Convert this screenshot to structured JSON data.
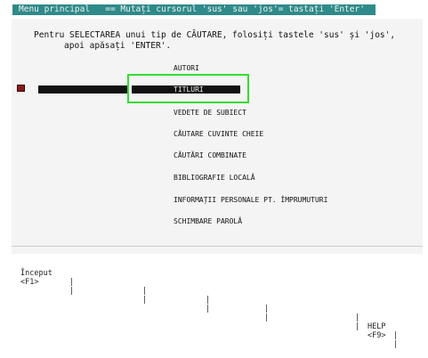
{
  "header": {
    "title": "Menu principal   == Mutați cursorul 'sus' sau 'jos'= tastați 'Enter'"
  },
  "instructions": {
    "line1": "Pentru SELECTAREA unui tip de CĂUTARE, folosiți tastele 'sus' și 'jos',",
    "line2": "apoi apăsați 'ENTER'."
  },
  "menu": {
    "items": [
      {
        "label": "AUTORI"
      },
      {
        "label": "TITLURI"
      },
      {
        "label": "VEDETE DE SUBIECT"
      },
      {
        "label": "CĂUTARE CUVINTE CHEIE"
      },
      {
        "label": "CĂUTĂRI COMBINATE"
      },
      {
        "label": "BIBLIOGRAFIE LOCALĂ"
      },
      {
        "label": "INFORMAȚII PERSONALE PT. ÎMPRUMUTURI"
      },
      {
        "label": "SCHIMBARE PAROLĂ"
      }
    ],
    "selected_index": 1
  },
  "function_keys": {
    "f1_label": "Început",
    "f1_key": "<F1>",
    "help_label": "HELP",
    "help_key": "<F9>"
  },
  "colors": {
    "header_bg": "#2f8a8a",
    "selection_outline": "#33dd33",
    "marker": "#8b1a1a"
  }
}
